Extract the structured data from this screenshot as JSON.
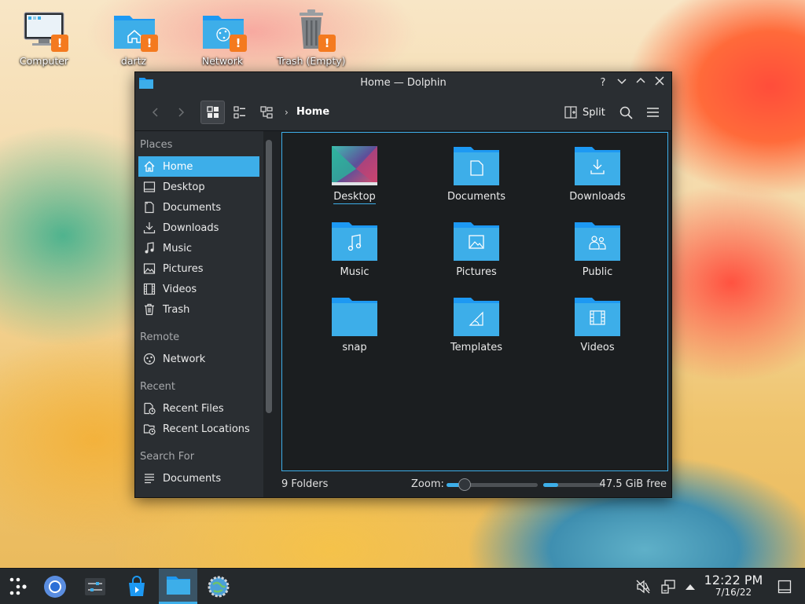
{
  "desktop": {
    "icons": [
      {
        "label": "Computer"
      },
      {
        "label": "dartz"
      },
      {
        "label": "Network"
      },
      {
        "label": "Trash (Empty)"
      }
    ],
    "warning_mark": "!"
  },
  "window": {
    "title": "Home — Dolphin",
    "buttons": {
      "help": "?",
      "minimize": "⌄",
      "maximize": "⌃",
      "close": "✕"
    }
  },
  "toolbar": {
    "breadcrumb": "Home",
    "breadcrumb_separator": "›",
    "split_label": "Split"
  },
  "sidebar": {
    "sections": [
      {
        "header": "Places",
        "items": [
          "Home",
          "Desktop",
          "Documents",
          "Downloads",
          "Music",
          "Pictures",
          "Videos",
          "Trash"
        ]
      },
      {
        "header": "Remote",
        "items": [
          "Network"
        ]
      },
      {
        "header": "Recent",
        "items": [
          "Recent Files",
          "Recent Locations"
        ]
      },
      {
        "header": "Search For",
        "items": [
          "Documents"
        ]
      }
    ],
    "selected": "Home"
  },
  "files": [
    {
      "name": "Desktop",
      "icon": "desktop-folder-icon"
    },
    {
      "name": "Documents",
      "icon": "documents-folder-icon"
    },
    {
      "name": "Downloads",
      "icon": "downloads-folder-icon"
    },
    {
      "name": "Music",
      "icon": "music-folder-icon"
    },
    {
      "name": "Pictures",
      "icon": "pictures-folder-icon"
    },
    {
      "name": "Public",
      "icon": "public-folder-icon"
    },
    {
      "name": "snap",
      "icon": "folder-icon"
    },
    {
      "name": "Templates",
      "icon": "templates-folder-icon"
    },
    {
      "name": "Videos",
      "icon": "videos-folder-icon"
    }
  ],
  "statusbar": {
    "summary": "9 Folders",
    "zoom_label": "Zoom:",
    "zoom_level": 0.2,
    "disk_used_fraction": 0.25,
    "free_space": "47.5 GiB free"
  },
  "taskbar": {
    "time": "12:22 PM",
    "date": "7/16/22"
  },
  "colors": {
    "accent": "#3daee9",
    "folder": "#3daee9",
    "folder_dark": "#1d99f3",
    "warning": "#f47a1f",
    "window_bg": "#202326"
  }
}
